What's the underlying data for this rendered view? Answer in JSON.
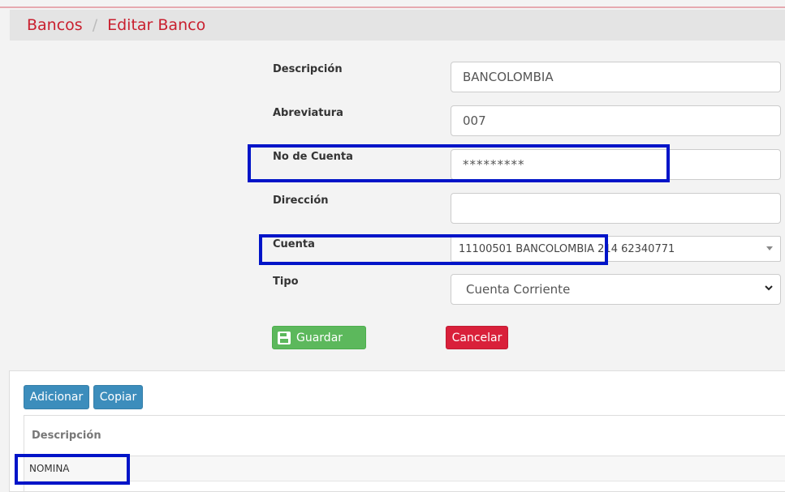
{
  "breadcrumb": {
    "parent": "Bancos",
    "separator": "/",
    "current": "Editar Banco"
  },
  "form": {
    "descripcion": {
      "label": "Descripción",
      "value": "BANCOLOMBIA"
    },
    "abreviatura": {
      "label": "Abreviatura",
      "value": "007"
    },
    "no_cuenta": {
      "label": "No de Cuenta",
      "value": "*********"
    },
    "direccion": {
      "label": "Dirección",
      "value": ""
    },
    "cuenta": {
      "label": "Cuenta",
      "value": "11100501 BANCOLOMBIA 214 62340771"
    },
    "tipo": {
      "label": "Tipo",
      "value": "Cuenta Corriente"
    },
    "save_label": "Guardar",
    "cancel_label": "Cancelar"
  },
  "list": {
    "add_label": "Adicionar",
    "copy_label": "Copiar",
    "columns": [
      "Descripción"
    ],
    "rows": [
      [
        "NOMINA"
      ]
    ]
  },
  "colors": {
    "brand_red": "#c9202f",
    "save_green": "#5cb85c",
    "cancel_red": "#d9203a",
    "primary_blue": "#3c8dbc",
    "highlight_blue": "#0014c8"
  }
}
